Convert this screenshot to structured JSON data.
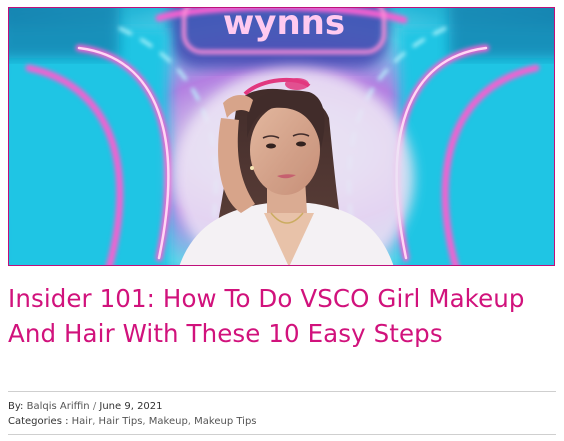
{
  "post": {
    "title": "Insider 101: How To Do VSCO Girl Makeup And Hair With These 10 Easy Steps",
    "byline": {
      "by_label": "By:",
      "author": "Balqis Ariffin",
      "separator": "/",
      "date": "June 9, 2021"
    },
    "categories": {
      "label": "Categories :",
      "items": [
        "Hair",
        "Hair Tips",
        "Makeup",
        "Makeup Tips"
      ]
    }
  },
  "colors": {
    "accent": "#d1127c",
    "image_border": "#c0107a",
    "neon_cyan": "#22c7e6",
    "neon_pink": "#e43fb6",
    "rule": "#cfcfcf"
  },
  "image": {
    "neon_sign_text": "wynns"
  }
}
